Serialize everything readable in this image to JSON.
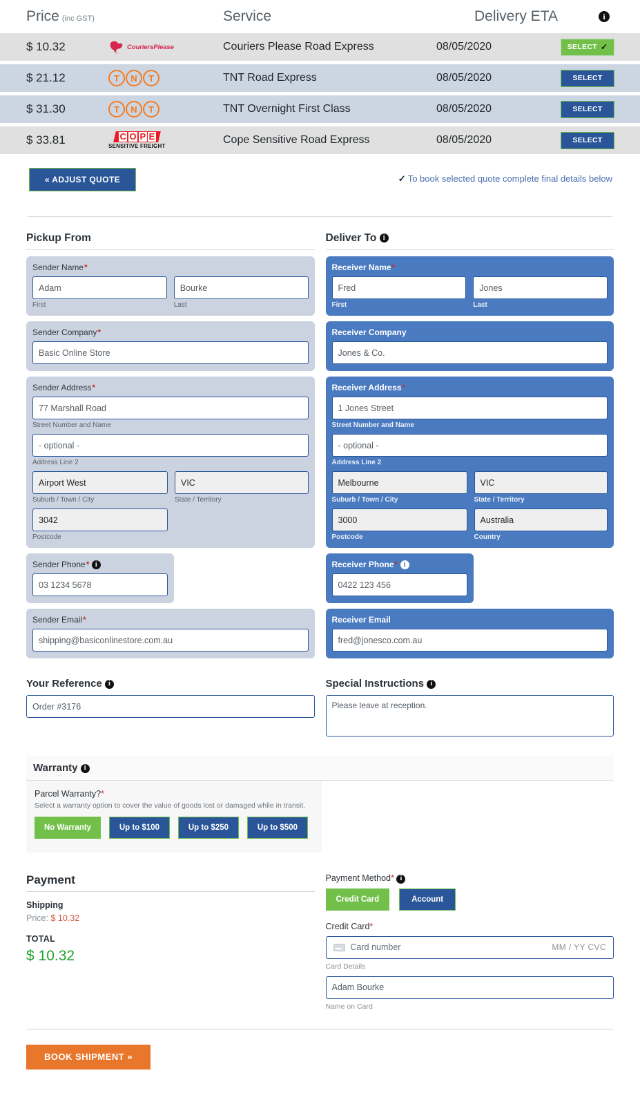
{
  "quote_table": {
    "headers": {
      "price": "Price",
      "price_note": "(inc GST)",
      "service": "Service",
      "eta": "Delivery ETA",
      "info_icon": "info-icon"
    },
    "rows": [
      {
        "price": "$ 10.32",
        "carrier": "CouriersPlease",
        "carrier_logo": "couriers-please-logo",
        "service": "Couriers Please Road Express",
        "eta": "08/05/2020",
        "button_label": "SELECT",
        "selected": true,
        "check": "✓"
      },
      {
        "price": "$ 21.12",
        "carrier": "TNT",
        "carrier_logo": "tnt-logo",
        "service": "TNT Road Express",
        "eta": "08/05/2020",
        "button_label": "SELECT",
        "selected": false,
        "check": ""
      },
      {
        "price": "$ 31.30",
        "carrier": "TNT",
        "carrier_logo": "tnt-logo",
        "service": "TNT Overnight First Class",
        "eta": "08/05/2020",
        "button_label": "SELECT",
        "selected": false,
        "check": ""
      },
      {
        "price": "$ 33.81",
        "carrier": "COPE SENSITIVE FREIGHT",
        "carrier_logo": "cope-logo",
        "service": "Cope Sensitive Road Express",
        "eta": "08/05/2020",
        "button_label": "SELECT",
        "selected": false,
        "check": ""
      }
    ]
  },
  "actions": {
    "adjust_quote": "«  ADJUST QUOTE",
    "book_note_tick": "✓",
    "book_note": "To book selected quote complete final details below"
  },
  "pickup": {
    "title": "Pickup From",
    "name": {
      "label": "Sender Name",
      "required": "*",
      "first_value": "Adam",
      "first_hint": "First",
      "last_value": "Bourke",
      "last_hint": "Last"
    },
    "company": {
      "label": "Sender Company",
      "required": "*",
      "value": "Basic Online Store"
    },
    "address": {
      "label": "Sender Address",
      "required": "*",
      "street_value": "77 Marshall Road",
      "street_hint": "Street Number and Name",
      "line2_value": "- optional -",
      "line2_hint": "Address Line 2",
      "suburb_value": "Airport West",
      "suburb_hint": "Suburb / Town / City",
      "state_value": "VIC",
      "state_hint": "State / Territory",
      "postcode_value": "3042",
      "postcode_hint": "Postcode"
    },
    "phone": {
      "label": "Sender Phone",
      "required": "*",
      "value": "03 1234 5678"
    },
    "email": {
      "label": "Sender Email",
      "required": "*",
      "value": "shipping@basiconlinestore.com.au"
    }
  },
  "deliver": {
    "title": "Deliver To",
    "name": {
      "label": "Receiver Name",
      "required": "*",
      "first_value": "Fred",
      "first_hint": "First",
      "last_value": "Jones",
      "last_hint": "Last"
    },
    "company": {
      "label": "Receiver Company",
      "required": "",
      "value": "Jones & Co."
    },
    "address": {
      "label": "Receiver Address",
      "required": "*",
      "street_value": "1 Jones Street",
      "street_hint": "Street Number and Name",
      "line2_value": "- optional -",
      "line2_hint": "Address Line 2",
      "suburb_value": "Melbourne",
      "suburb_hint": "Suburb / Town / City",
      "state_value": "VIC",
      "state_hint": "State / Territory",
      "postcode_value": "3000",
      "postcode_hint": "Postcode",
      "country_value": "Australia",
      "country_hint": "Country"
    },
    "phone": {
      "label": "Receiver Phone",
      "required": "*",
      "value": "0422 123 456"
    },
    "email": {
      "label": "Receiver Email",
      "required": "",
      "value": "fred@jonesco.com.au"
    }
  },
  "reference": {
    "title": "Your Reference",
    "value": "Order #3176"
  },
  "special_instructions": {
    "title": "Special Instructions",
    "value": "Please leave at reception."
  },
  "warranty": {
    "title": "Warranty",
    "question": "Parcel Warranty?",
    "required": "*",
    "description": "Select a warranty option to cover the value of goods lost or damaged while in transit.",
    "options": [
      {
        "label": "No Warranty",
        "selected": true
      },
      {
        "label": "Up to $100",
        "selected": false
      },
      {
        "label": "Up to $250",
        "selected": false
      },
      {
        "label": "Up to $500",
        "selected": false
      }
    ]
  },
  "payment": {
    "title": "Payment",
    "shipping_label": "Shipping",
    "price_prefix": "Price: ",
    "price_value": "$ 10.32",
    "total_label": "TOTAL",
    "total_value": "$ 10.32",
    "method_label": "Payment Method",
    "required": "*",
    "methods": [
      {
        "label": "Credit Card",
        "selected": true
      },
      {
        "label": "Account",
        "selected": false
      }
    ],
    "credit_card_label": "Credit Card",
    "card_number_placeholder": "Card number",
    "card_expiry_placeholder": "MM / YY  CVC",
    "card_details_hint": "Card Details",
    "name_on_card_value": "Adam Bourke",
    "name_on_card_hint": "Name on Card"
  },
  "footer": {
    "book_shipment": "BOOK SHIPMENT »"
  },
  "colors": {
    "primary_blue": "#2a5699",
    "panel_blue": "#4a7ac0",
    "green": "#72c04a",
    "orange": "#e8762b",
    "total_green": "#22a02c",
    "price_red": "#d0553b"
  }
}
